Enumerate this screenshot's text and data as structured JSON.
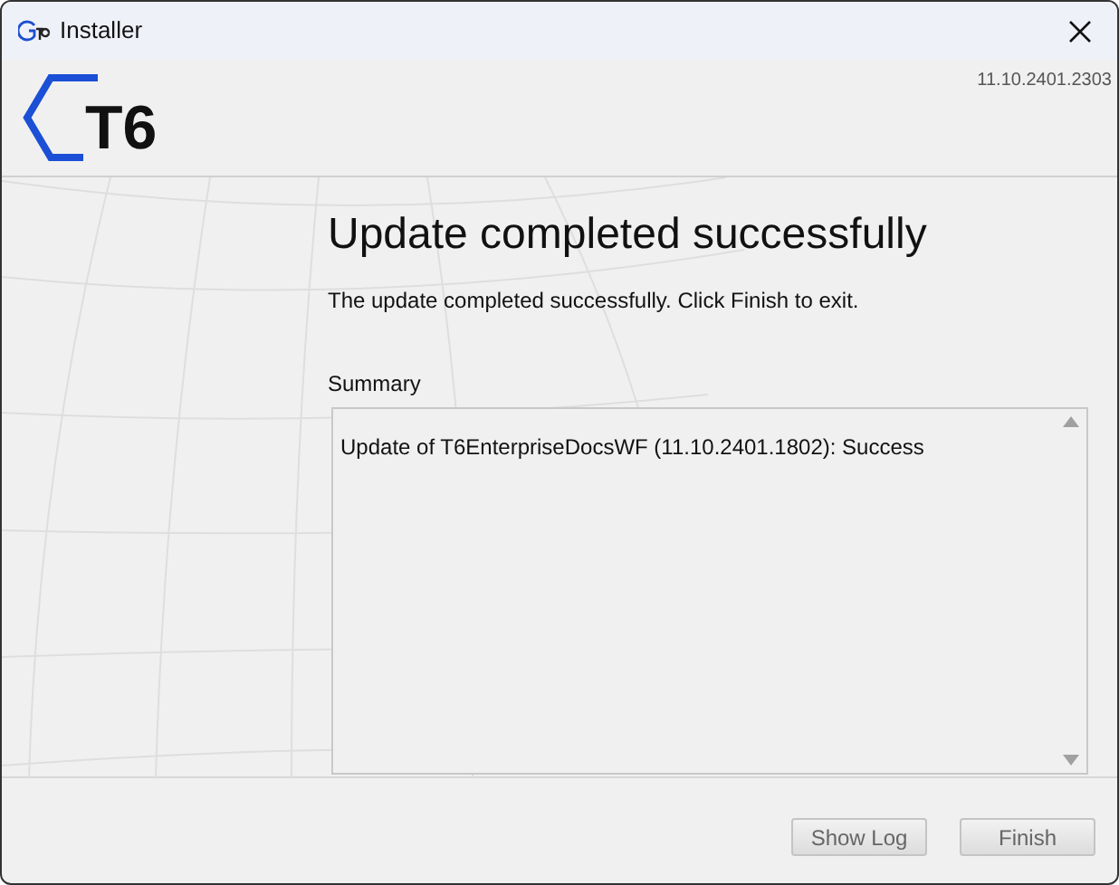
{
  "window": {
    "title": "Installer"
  },
  "header": {
    "logo_text": "T6",
    "version": "11.10.2401.2303"
  },
  "heading": "Update completed successfully",
  "message": "The update completed successfully. Click Finish to exit.",
  "summary": {
    "label": "Summary",
    "lines": [
      "Update of T6EnterpriseDocsWF (11.10.2401.1802): Success"
    ]
  },
  "buttons": [
    {
      "label": "Show Log"
    },
    {
      "label": "Finish"
    }
  ]
}
